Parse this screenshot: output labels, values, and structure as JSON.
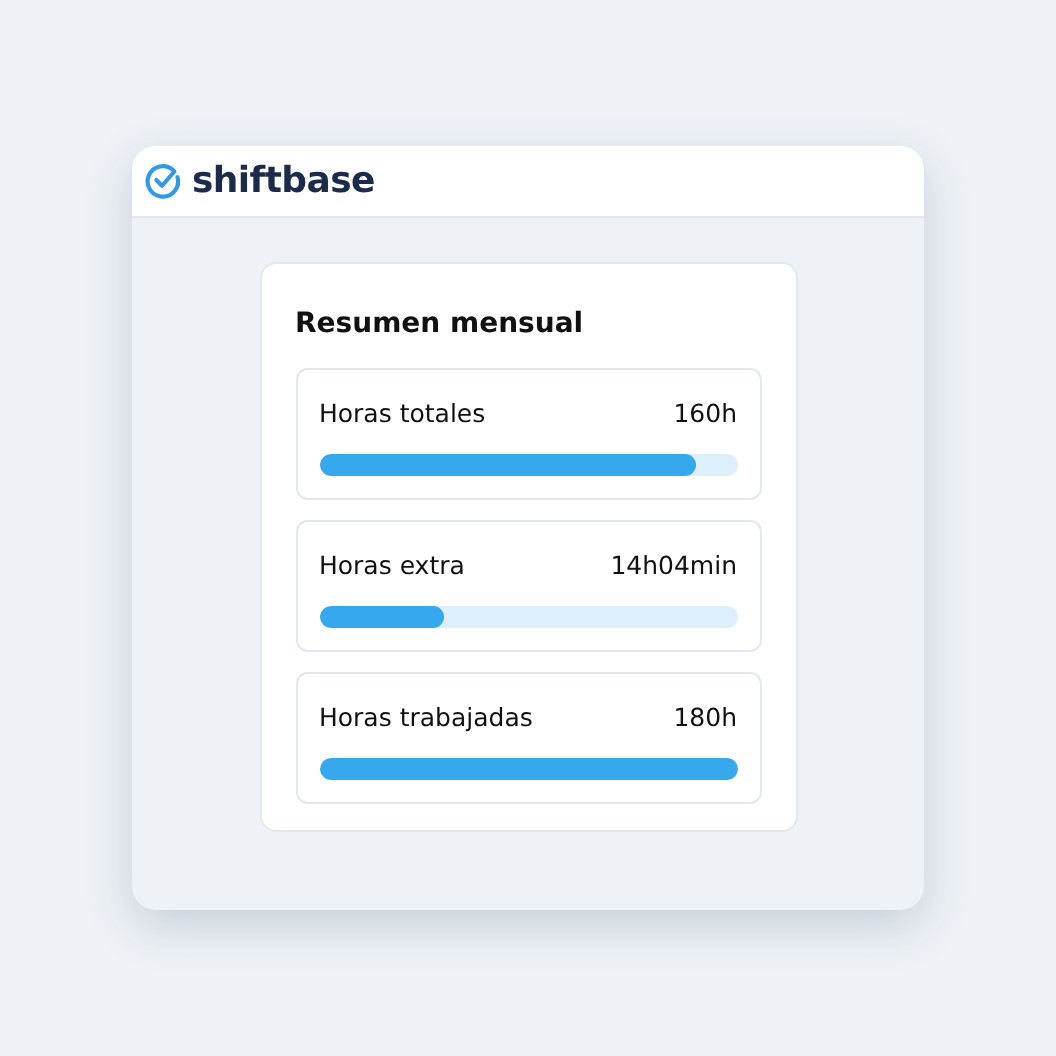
{
  "header": {
    "logo_text": "shiftbase"
  },
  "summary": {
    "title": "Resumen mensual",
    "rows": [
      {
        "label": "Horas totales",
        "value": "160h",
        "level": 0.9
      },
      {
        "label": "Horas extra",
        "value": "14h04min",
        "level": 0.3
      },
      {
        "label": "Horas trabajadas",
        "value": "180h",
        "level": 1
      }
    ]
  }
}
